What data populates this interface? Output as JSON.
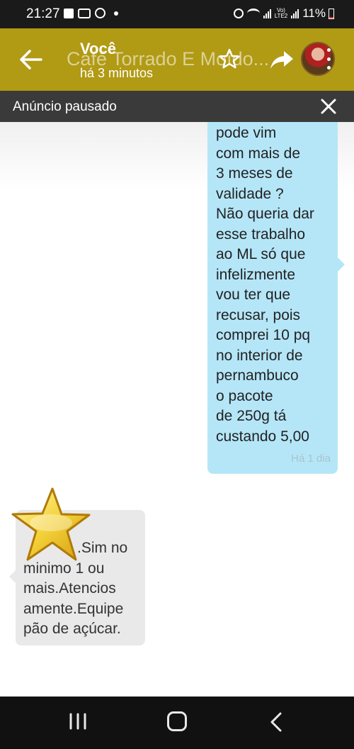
{
  "status_bar": {
    "time": "21:27",
    "battery": "11%",
    "network_label": "Vo) LTE2",
    "icons": [
      "image-icon",
      "incognito-icon",
      "whatsapp-icon",
      "notification-dot",
      "alarm-icon",
      "wifi-icon",
      "signal-icon",
      "battery-icon"
    ]
  },
  "header": {
    "title": "Café Torrado E Moído...",
    "sender": "Você",
    "last_seen": "há 3 minutos",
    "icons": [
      "back-arrow-icon",
      "star-outline-icon",
      "share-icon",
      "kebab-menu-icon"
    ]
  },
  "notice": {
    "text": "Anúncio pausado"
  },
  "messages": [
    {
      "direction": "outgoing",
      "lines": [
        "pode vim",
        "com mais de",
        "3 meses de",
        "validade ?",
        "Não queria dar",
        "esse trabalho",
        "ao ML só que",
        "infelizmente",
        "vou ter que",
        "recusar, pois",
        "comprei 10 pq",
        "no interior de",
        "pernambuco",
        "o pacote",
        "de 250g tá",
        "custando 5,00"
      ],
      "time": "Há 1 dia",
      "color": "#b5e6f8"
    },
    {
      "direction": "incoming",
      "lines": [
        ".Sim no",
        "minimo 1 ou",
        "mais.Atencios",
        "amente.Equipe",
        "pão de açúcar."
      ],
      "color": "#e9e9e9"
    }
  ],
  "colors": {
    "app_bar": "#b19a14",
    "notice_bar": "#3a3a3a",
    "nav_bar": "#111111"
  },
  "nav": {
    "icons": [
      "recent-apps-icon",
      "home-icon",
      "back-icon"
    ]
  }
}
